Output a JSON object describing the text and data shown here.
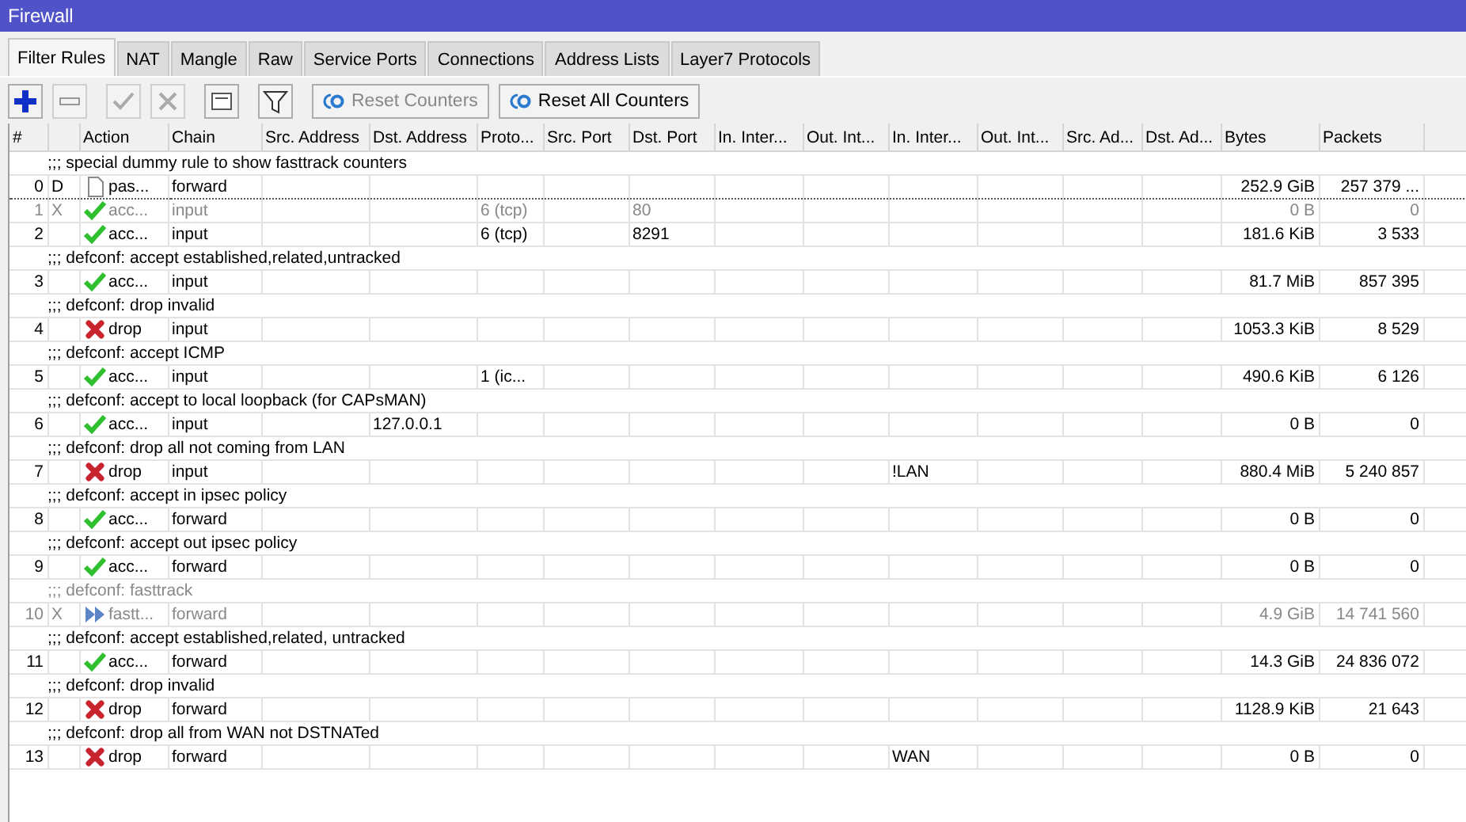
{
  "window": {
    "title": "Firewall"
  },
  "tabs": [
    {
      "label": "Filter Rules",
      "selected": true
    },
    {
      "label": "NAT",
      "selected": false
    },
    {
      "label": "Mangle",
      "selected": false
    },
    {
      "label": "Raw",
      "selected": false
    },
    {
      "label": "Service Ports",
      "selected": false
    },
    {
      "label": "Connections",
      "selected": false
    },
    {
      "label": "Address Lists",
      "selected": false
    },
    {
      "label": "Layer7 Protocols",
      "selected": false
    }
  ],
  "toolbar": [
    {
      "kind": "add",
      "disabled": false
    },
    {
      "kind": "remove",
      "disabled": true
    },
    {
      "kind": "enable",
      "disabled": true
    },
    {
      "kind": "disable",
      "disabled": true
    },
    {
      "kind": "comment",
      "disabled": false
    },
    {
      "kind": "filter",
      "disabled": false
    },
    {
      "kind": "reset",
      "label": "Reset Counters",
      "disabled": true
    },
    {
      "kind": "reset",
      "label": "Reset All Counters",
      "disabled": false
    }
  ],
  "table": {
    "columns": [
      "#",
      "Action",
      "Chain",
      "Src. Address",
      "Dst. Address",
      "Proto...",
      "Src. Port",
      "Dst. Port",
      "In. Inter...",
      "Out. Int...",
      "In. Inter...",
      "Out. Int...",
      "Src. Ad...",
      "Dst. Ad...",
      "Bytes",
      "Packets"
    ],
    "rules": [
      {
        "comment": ";;; special dummy rule to show fasttrack counters",
        "number": "0",
        "flag": "D",
        "kind": "passthrough",
        "action": "pas...",
        "chain": "forward",
        "bytes": "252.9 GiB",
        "packets": "257 379 ...",
        "disabled": false,
        "focused": true
      },
      {
        "number": "1",
        "flag": "X",
        "kind": "accept",
        "action": "acc...",
        "chain": "input",
        "protocol": "6 (tcp)",
        "dst_port": "80",
        "bytes": "0 B",
        "packets": "0",
        "disabled": true,
        "focused": false
      },
      {
        "number": "2",
        "kind": "accept",
        "action": "acc...",
        "chain": "input",
        "protocol": "6 (tcp)",
        "dst_port": "8291",
        "bytes": "181.6 KiB",
        "packets": "3 533",
        "disabled": false,
        "focused": false
      },
      {
        "comment": ";;; defconf: accept established,related,untracked",
        "number": "3",
        "kind": "accept",
        "action": "acc...",
        "chain": "input",
        "bytes": "81.7 MiB",
        "packets": "857 395",
        "disabled": false,
        "focused": false
      },
      {
        "comment": ";;; defconf: drop invalid",
        "number": "4",
        "kind": "drop",
        "action": "drop",
        "chain": "input",
        "bytes": "1053.3 KiB",
        "packets": "8 529",
        "disabled": false,
        "focused": false
      },
      {
        "comment": ";;; defconf: accept ICMP",
        "number": "5",
        "kind": "accept",
        "action": "acc...",
        "chain": "input",
        "protocol": "1 (ic...",
        "bytes": "490.6 KiB",
        "packets": "6 126",
        "disabled": false,
        "focused": false
      },
      {
        "comment": ";;; defconf: accept to local loopback (for CAPsMAN)",
        "number": "6",
        "kind": "accept",
        "action": "acc...",
        "chain": "input",
        "dst_address": "127.0.0.1",
        "bytes": "0 B",
        "packets": "0",
        "disabled": false,
        "focused": false
      },
      {
        "comment": ";;; defconf: drop all not coming from LAN",
        "number": "7",
        "kind": "drop",
        "action": "drop",
        "chain": "input",
        "in_interface_list": "!LAN",
        "bytes": "880.4 MiB",
        "packets": "5 240 857",
        "disabled": false,
        "focused": false
      },
      {
        "comment": ";;; defconf: accept in ipsec policy",
        "number": "8",
        "kind": "accept",
        "action": "acc...",
        "chain": "forward",
        "bytes": "0 B",
        "packets": "0",
        "disabled": false,
        "focused": false
      },
      {
        "comment": ";;; defconf: accept out ipsec policy",
        "number": "9",
        "kind": "accept",
        "action": "acc...",
        "chain": "forward",
        "bytes": "0 B",
        "packets": "0",
        "disabled": false,
        "focused": false
      },
      {
        "comment": ";;; defconf: fasttrack",
        "number": "10",
        "flag": "X",
        "kind": "fasttrack",
        "action": "fastt...",
        "chain": "forward",
        "bytes": "4.9 GiB",
        "packets": "14 741 560",
        "disabled": true,
        "focused": false
      },
      {
        "comment": ";;; defconf: accept established,related, untracked",
        "number": "11",
        "kind": "accept",
        "action": "acc...",
        "chain": "forward",
        "bytes": "14.3 GiB",
        "packets": "24 836 072",
        "disabled": false,
        "focused": false
      },
      {
        "comment": ";;; defconf: drop invalid",
        "number": "12",
        "kind": "drop",
        "action": "drop",
        "chain": "forward",
        "bytes": "1128.9 KiB",
        "packets": "21 643",
        "disabled": false,
        "focused": false
      },
      {
        "comment": ";;; defconf: drop all from WAN not DSTNATed",
        "number": "13",
        "kind": "drop",
        "action": "drop",
        "chain": "forward",
        "in_interface_list": "WAN",
        "bytes": "0 B",
        "packets": "0",
        "disabled": false,
        "focused": false
      }
    ]
  }
}
